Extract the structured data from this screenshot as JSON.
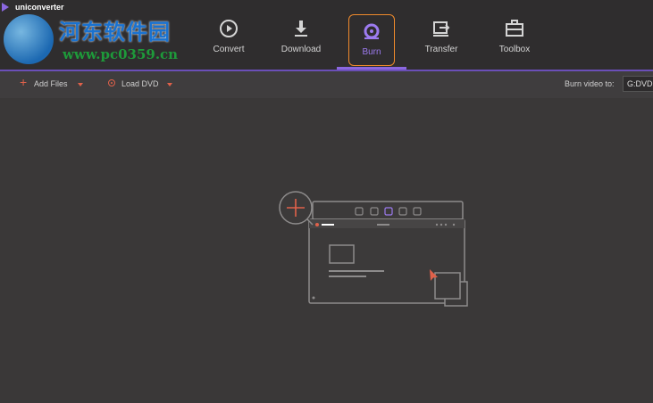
{
  "app": {
    "title": "uniconverter"
  },
  "watermark": {
    "cn_text": "河东软件园",
    "url": "www.pc0359.cn"
  },
  "nav": {
    "tabs": [
      {
        "label": "Convert",
        "icon": "convert-icon",
        "active": false
      },
      {
        "label": "Download",
        "icon": "download-icon",
        "active": false
      },
      {
        "label": "Burn",
        "icon": "burn-icon",
        "active": true
      },
      {
        "label": "Transfer",
        "icon": "transfer-icon",
        "active": false
      },
      {
        "label": "Toolbox",
        "icon": "toolbox-icon",
        "active": false
      }
    ]
  },
  "toolbar": {
    "add_files": "Add Files",
    "load_dvd": "Load DVD",
    "burn_to_label": "Burn video to:",
    "burn_to_value": "G:DVD+"
  },
  "colors": {
    "accent_purple": "#8b67e0",
    "active_border": "#f08a2c",
    "icon_red": "#e0614a",
    "background": "#3a3838"
  }
}
